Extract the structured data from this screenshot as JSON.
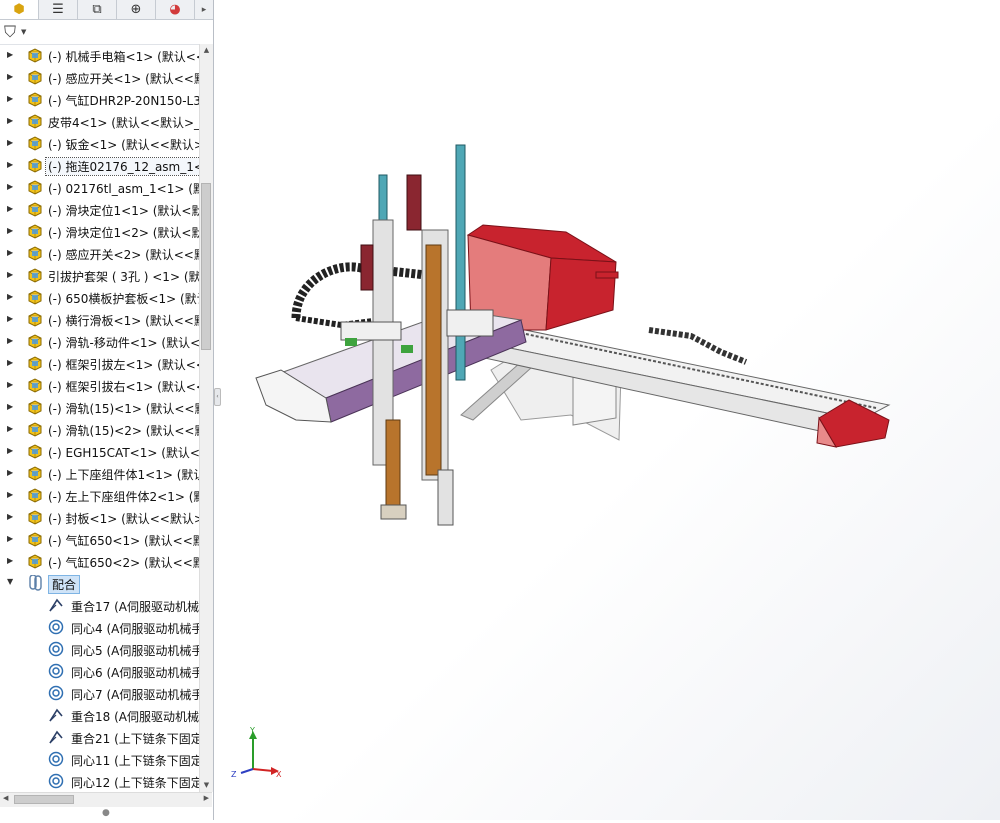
{
  "left_panel": {
    "tabs": [
      {
        "icon": "assembly-icon",
        "glyph": "⬢"
      },
      {
        "icon": "property-manager-icon",
        "glyph": "☰"
      },
      {
        "icon": "configuration-manager-icon",
        "glyph": "⧉"
      },
      {
        "icon": "dimxpert-icon",
        "glyph": "⊕"
      },
      {
        "icon": "display-manager-icon",
        "glyph": "◕"
      }
    ],
    "tab_more_glyph": "▸",
    "filter_glyph": "⛉",
    "filter_caret": "▼",
    "tree_items": [
      "(-) 机械手电箱<1> (默认<<默",
      "(-) 感应开关<1> (默认<<默",
      "(-) 气缸DHR2P-20N150-L3",
      "皮带4<1> (默认<<默认>_显",
      "(-) 钣金<1> (默认<<默认>",
      "(-) 拖连02176_12_asm_1<1",
      "(-) 02176tl_asm_1<1> (默",
      "(-) 滑块定位1<1> (默认<默",
      "(-) 滑块定位1<2> (默认<默",
      "(-) 感应开关<2> (默认<<默",
      "引拔护套架 ( 3孔 ) <1> (默",
      "(-) 650横板护套板<1> (默认",
      "(-) 横行滑板<1> (默认<<默",
      "(-) 滑轨-移动件<1> (默认<",
      "(-) 框架引拔左<1> (默认<<",
      "(-) 框架引拔右<1> (默认<<",
      "(-) 滑轨(15)<1> (默认<<默",
      "(-) 滑轨(15)<2> (默认<<默",
      "(-) EGH15CAT<1> (默认<<",
      "(-) 上下座组件体1<1> (默认",
      "(-) 左上下座组件体2<1> (默",
      "(-) 封板<1> (默认<<默认>",
      "(-) 气缸650<1> (默认<<默认",
      "(-) 气缸650<2> (默认<<默认"
    ],
    "mates_group_label": "配合",
    "mates": [
      {
        "type": "coincident",
        "label": "重合17 (A伺服驱动机械"
      },
      {
        "type": "concentric",
        "label": "同心4 (A伺服驱动机械手"
      },
      {
        "type": "concentric",
        "label": "同心5 (A伺服驱动机械手"
      },
      {
        "type": "concentric",
        "label": "同心6 (A伺服驱动机械手"
      },
      {
        "type": "concentric",
        "label": "同心7 (A伺服驱动机械手"
      },
      {
        "type": "coincident",
        "label": "重合18 (A伺服驱动机械"
      },
      {
        "type": "coincident",
        "label": "重合21 (上下链条下固定"
      },
      {
        "type": "concentric",
        "label": "同心11 (上下链条下固定"
      },
      {
        "type": "concentric",
        "label": "同心12 (上下链条下固定"
      }
    ]
  },
  "triad": {
    "y": "Y",
    "z": "Z",
    "x": "X"
  },
  "colors": {
    "part_icon": "#f2c21b",
    "selection": "#cfe3f7",
    "rail_purple": "#8e6aa0",
    "frame_red": "#c8232e",
    "upright_blue": "#4fa7b5",
    "upright_orange": "#b8742c"
  }
}
